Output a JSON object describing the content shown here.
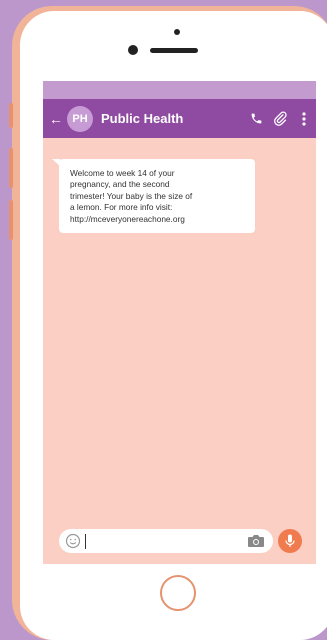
{
  "header": {
    "avatar_initials": "PH",
    "contact_name": "Public Health",
    "back_icon": "arrow-left-icon",
    "icons": [
      "phone-icon",
      "paperclip-icon",
      "more-vertical-icon"
    ]
  },
  "message": {
    "lines": [
      "Welcome to week 14 of your",
      "pregnancy, and the second",
      "trimester! Your baby is the size of",
      "a lemon. For more info visit:",
      "http://mceveryonereachone.org"
    ]
  },
  "input": {
    "value": "",
    "emoji_icon": "emoji-icon",
    "camera_icon": "camera-icon",
    "mic_icon": "microphone-icon"
  },
  "colors": {
    "header": "#8f4aa1",
    "chat_background": "#fbcfc3",
    "phone_frame": "#f1b498",
    "page_background": "#bb97cc",
    "mic_button": "#ef7b4e"
  }
}
